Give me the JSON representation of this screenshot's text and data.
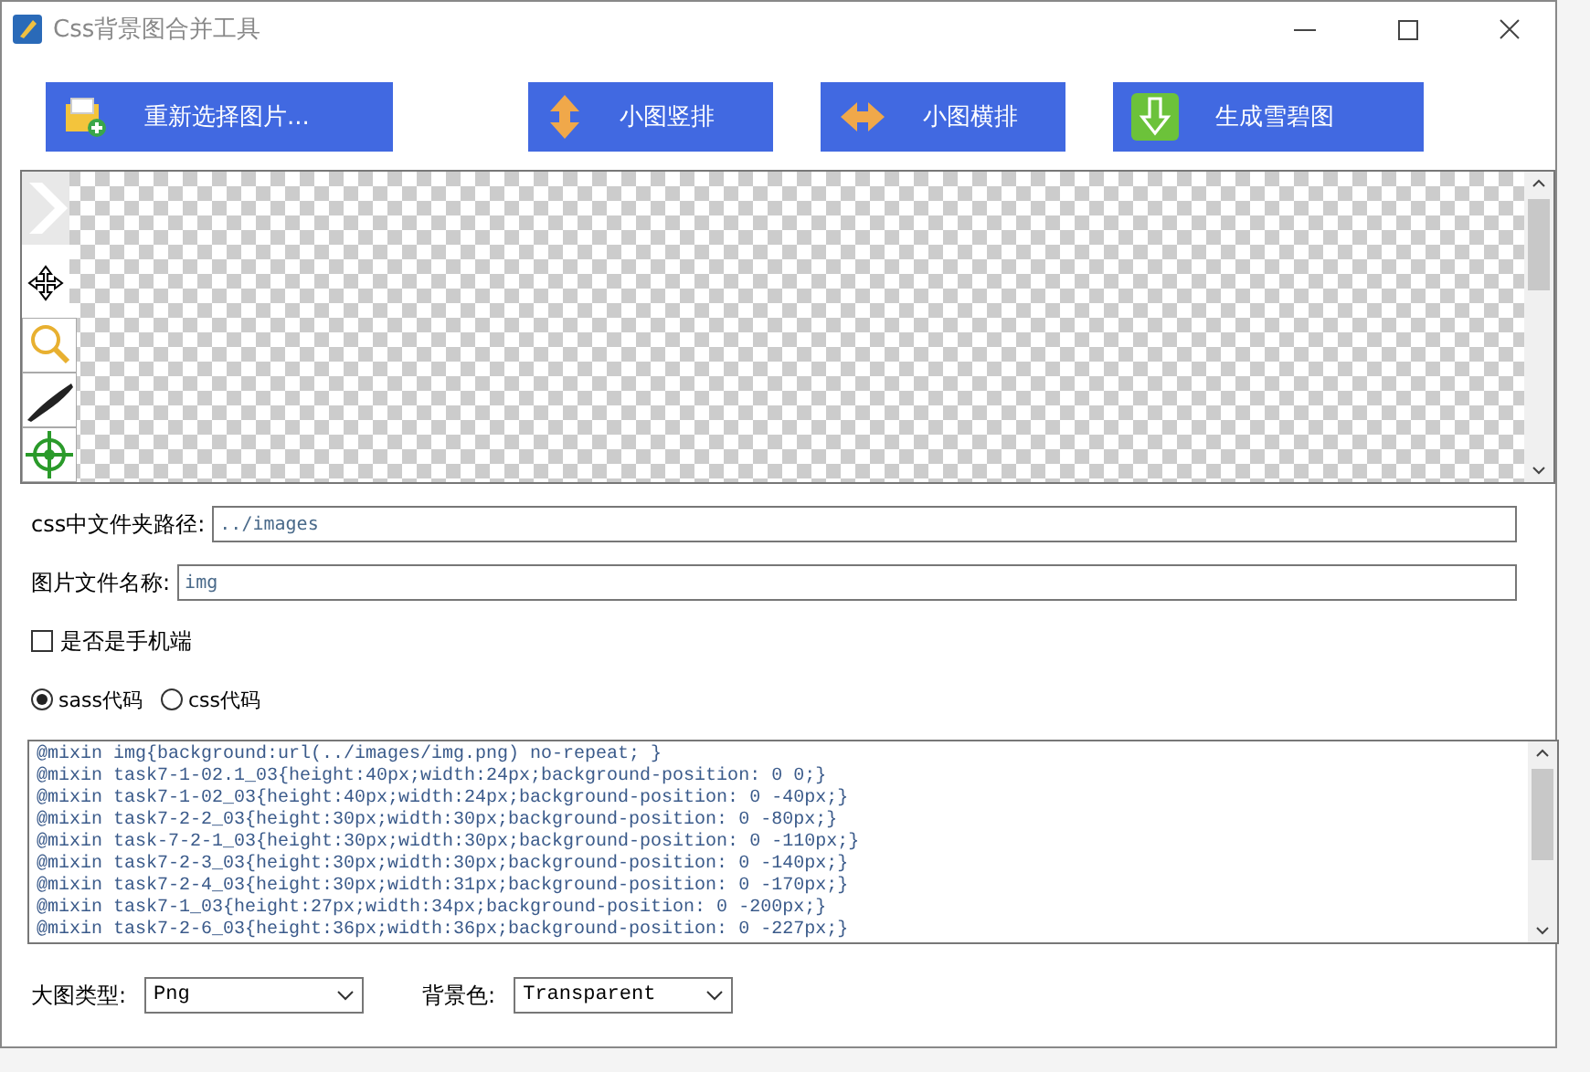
{
  "window": {
    "title": "Css背景图合并工具"
  },
  "toolbar": [
    {
      "label": "重新选择图片...",
      "kind": "open"
    },
    {
      "label": "小图竖排",
      "kind": "vertical"
    },
    {
      "label": "小图横排",
      "kind": "horizontal"
    },
    {
      "label": "生成雪碧图",
      "kind": "generate"
    }
  ],
  "canvas_tools": [
    {
      "kind": "chevron"
    },
    {
      "kind": "move"
    },
    {
      "kind": "zoom"
    },
    {
      "kind": "knife"
    },
    {
      "kind": "target"
    }
  ],
  "fields": [
    {
      "label": "css中文件夹路径:",
      "value": "../images"
    },
    {
      "label": "图片文件名称:",
      "value": "img"
    }
  ],
  "mobile": {
    "label": "是否是手机端",
    "checked": false
  },
  "code_type": [
    {
      "label": "sass代码",
      "selected": true
    },
    {
      "label": "css代码",
      "selected": false
    }
  ],
  "code_lines": [
    "@mixin img{background:url(../images/img.png) no-repeat; }",
    "@mixin task7-1-02.1_03{height:40px;width:24px;background-position: 0 0;}",
    "@mixin task7-1-02_03{height:40px;width:24px;background-position: 0 -40px;}",
    "@mixin task7-2-2_03{height:30px;width:30px;background-position: 0 -80px;}",
    "@mixin task-7-2-1_03{height:30px;width:30px;background-position: 0 -110px;}",
    "@mixin task7-2-3_03{height:30px;width:30px;background-position: 0 -140px;}",
    "@mixin task7-2-4_03{height:30px;width:31px;background-position: 0 -170px;}",
    "@mixin task7-1_03{height:27px;width:34px;background-position: 0 -200px;}",
    "@mixin task7-2-6_03{height:36px;width:36px;background-position: 0 -227px;}"
  ],
  "selects": [
    {
      "label": "大图类型:",
      "value": "Png"
    },
    {
      "label": "背景色:",
      "value": "Transparent"
    }
  ]
}
